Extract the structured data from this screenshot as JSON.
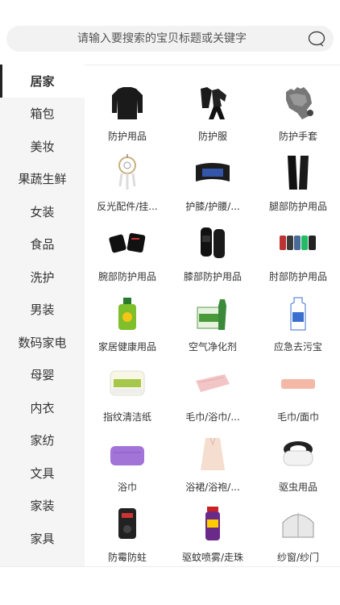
{
  "search": {
    "placeholder": "请输入要搜索的宝贝标题或关键字"
  },
  "sidebar": {
    "items": [
      {
        "label": "居家"
      },
      {
        "label": "箱包"
      },
      {
        "label": "美妆"
      },
      {
        "label": "果蔬生鲜"
      },
      {
        "label": "女装"
      },
      {
        "label": "食品"
      },
      {
        "label": "洗护"
      },
      {
        "label": "男装"
      },
      {
        "label": "数码家电"
      },
      {
        "label": "母婴"
      },
      {
        "label": "内衣"
      },
      {
        "label": "家纺"
      },
      {
        "label": "文具"
      },
      {
        "label": "家装"
      },
      {
        "label": "家具"
      }
    ]
  },
  "categories": [
    {
      "label": "防护用品",
      "icon": "black-shirt-icon"
    },
    {
      "label": "防护服",
      "icon": "black-suit-icon"
    },
    {
      "label": "防护手套",
      "icon": "glove-icon"
    },
    {
      "label": "反光配件/挂...",
      "icon": "dreamcatcher-icon"
    },
    {
      "label": "护膝/护腰/...",
      "icon": "waist-brace-icon"
    },
    {
      "label": "腿部防护用品",
      "icon": "leg-sleeve-icon"
    },
    {
      "label": "腕部防护用品",
      "icon": "wristband-icon"
    },
    {
      "label": "膝部防护用品",
      "icon": "knee-pad-icon"
    },
    {
      "label": "肘部防护用品",
      "icon": "elbow-pad-icon"
    },
    {
      "label": "家居健康用品",
      "icon": "detergent-bottle-icon"
    },
    {
      "label": "空气净化剂",
      "icon": "air-purifier-box-icon"
    },
    {
      "label": "应急去污宝",
      "icon": "spray-bottle-icon"
    },
    {
      "label": "指纹清洁纸",
      "icon": "tissue-roll-icon"
    },
    {
      "label": "毛巾/浴巾/...",
      "icon": "towel-pink-icon"
    },
    {
      "label": "毛巾/面巾",
      "icon": "towel-peach-icon"
    },
    {
      "label": "浴巾",
      "icon": "bath-towel-purple-icon"
    },
    {
      "label": "浴裙/浴袍/...",
      "icon": "bathrobe-icon"
    },
    {
      "label": "驱虫用品",
      "icon": "mosquito-device-icon"
    },
    {
      "label": "防霉防蛀",
      "icon": "dehumidifier-icon"
    },
    {
      "label": "驱蚊喷雾/走珠",
      "icon": "insect-spray-icon"
    },
    {
      "label": "纱窗/纱门",
      "icon": "mosquito-net-icon"
    }
  ]
}
